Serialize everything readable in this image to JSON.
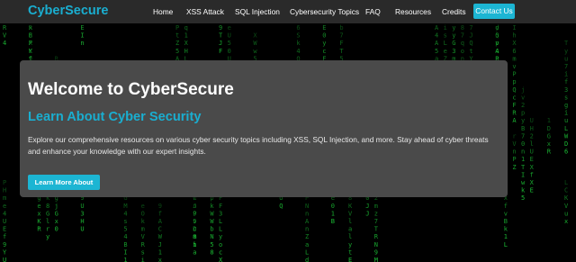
{
  "header": {
    "brand": "CyberSecure",
    "nav_items": [
      {
        "label": "Home"
      },
      {
        "label": "XSS Attack"
      },
      {
        "label": "SQL Injection"
      },
      {
        "label": "Cybersecurity Topics"
      },
      {
        "label": "FAQ"
      },
      {
        "label": "Resources"
      },
      {
        "label": "Credits"
      }
    ],
    "contact_label": "Contact Us"
  },
  "hero": {
    "title": "Welcome to CyberSecure",
    "subtitle": "Learn About Cyber Security",
    "description": "Explore our comprehensive resources on various cyber security topics including XSS, SQL Injection, and more. Stay ahead of cyber threats and enhance your knowledge with our expert insights.",
    "button_label": "Learn More About"
  },
  "background": {
    "effect": "matrix-rain",
    "character_set": "0123456789ABCDEFGHIJKLMNOPQRSTUVWXYZabcdefghijklmnopqrstuvwxyz"
  },
  "colors": {
    "accent": "#1cb5d3",
    "brand": "#1aaed0",
    "navbar": "#2a2a2a",
    "card": "#4a4a4a",
    "matrix": "#1fd13b",
    "page_bg": "#000000"
  }
}
